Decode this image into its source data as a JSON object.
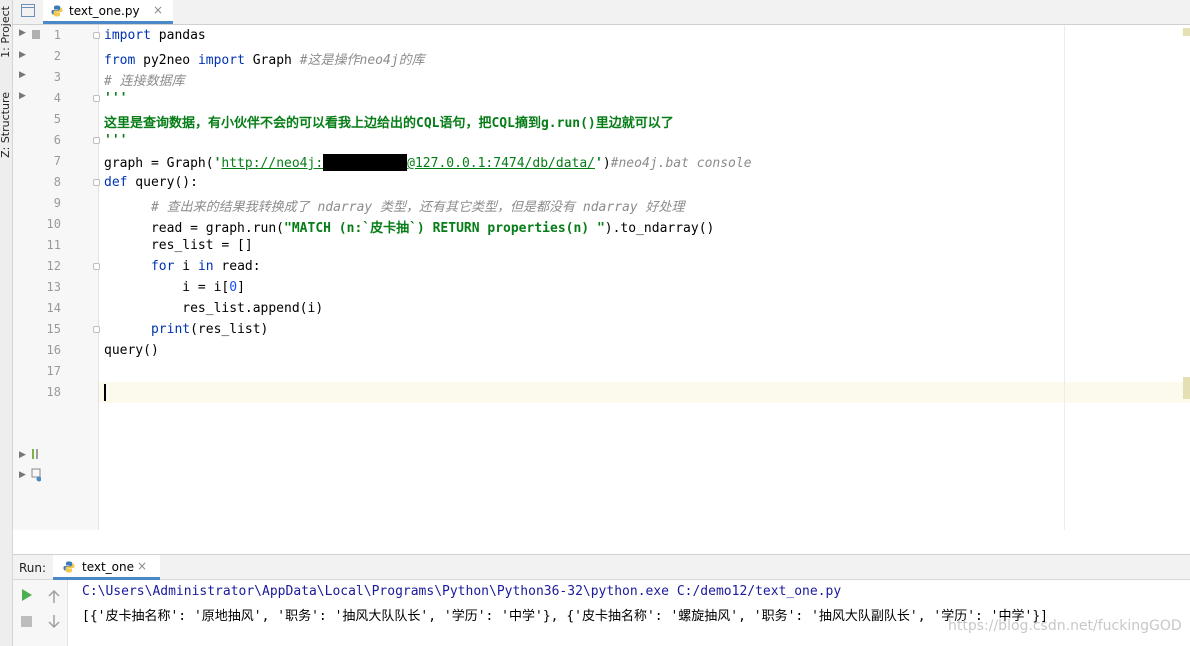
{
  "toolwindows": {
    "project": "1: Project",
    "structure": "Z: Structure"
  },
  "editor_tab": {
    "title": "text_one.py",
    "close": "×"
  },
  "code_lines": [
    {
      "n": "1",
      "tokens": [
        [
          "kw",
          "import"
        ],
        [
          "",
          " pandas"
        ]
      ]
    },
    {
      "n": "2",
      "tokens": [
        [
          "kw",
          "from"
        ],
        [
          "",
          " py2neo "
        ],
        [
          "kw",
          "import"
        ],
        [
          "",
          " Graph "
        ],
        [
          "cmt",
          "#这是操作neo4j的库"
        ]
      ]
    },
    {
      "n": "3",
      "tokens": [
        [
          "cmt",
          "# 连接数据库"
        ]
      ]
    },
    {
      "n": "4",
      "tokens": [
        [
          "str",
          "'''"
        ]
      ]
    },
    {
      "n": "5",
      "tokens": [
        [
          "str",
          "这里是查询数据，有小伙伴不会的可以看我上边给出的CQL语句，把CQL摘到g.run()里边就可以了"
        ]
      ]
    },
    {
      "n": "6",
      "tokens": [
        [
          "str",
          "'''"
        ]
      ]
    },
    {
      "n": "7",
      "tokens": [
        [
          "",
          "graph = Graph("
        ],
        [
          "str",
          "'"
        ],
        [
          "url",
          "http://neo4j:"
        ],
        [
          "redact",
          ""
        ],
        [
          "url",
          "@127.0.0.1:7474/db/data/"
        ],
        [
          "str",
          "'"
        ],
        [
          "",
          ")"
        ],
        [
          "cmt",
          "#neo4j.bat console"
        ]
      ]
    },
    {
      "n": "8",
      "tokens": [
        [
          "kw",
          "def"
        ],
        [
          "",
          " query():"
        ]
      ]
    },
    {
      "n": "9",
      "tokens": [
        [
          "",
          "      "
        ],
        [
          "cmt",
          "# 查出来的结果我转换成了 ndarray 类型，还有其它类型，但是都没有 ndarray 好处理"
        ]
      ]
    },
    {
      "n": "10",
      "tokens": [
        [
          "",
          "      read = graph.run("
        ],
        [
          "str",
          "\"MATCH (n:`皮卡抽`) RETURN properties(n) \""
        ],
        [
          "",
          ").to_ndarray()"
        ]
      ]
    },
    {
      "n": "11",
      "tokens": [
        [
          "",
          "      res_list = []"
        ]
      ]
    },
    {
      "n": "12",
      "tokens": [
        [
          "",
          "      "
        ],
        [
          "kw",
          "for"
        ],
        [
          "",
          " i "
        ],
        [
          "kw",
          "in"
        ],
        [
          "",
          " read:"
        ]
      ]
    },
    {
      "n": "13",
      "tokens": [
        [
          "",
          "          i = i["
        ],
        [
          "num",
          "0"
        ],
        [
          "",
          "]"
        ]
      ]
    },
    {
      "n": "14",
      "tokens": [
        [
          "",
          "          res_list.append(i)"
        ]
      ]
    },
    {
      "n": "15",
      "tokens": [
        [
          "",
          "      "
        ],
        [
          "kw",
          "print"
        ],
        [
          "",
          "(res_list)"
        ]
      ]
    },
    {
      "n": "16",
      "tokens": [
        [
          "",
          "query()"
        ]
      ]
    },
    {
      "n": "17",
      "tokens": []
    },
    {
      "n": "18",
      "tokens": []
    }
  ],
  "run_panel": {
    "label": "Run:",
    "tab_title": "text_one",
    "tab_close": "×",
    "command": "C:\\Users\\Administrator\\AppData\\Local\\Programs\\Python\\Python36-32\\python.exe C:/demo12/text_one.py",
    "output": "[{'皮卡抽名称': '原地抽风', '职务': '抽风大队队长', '学历': '中学'}, {'皮卡抽名称': '螺旋抽风', '职务': '抽风大队副队长', '学历': '中学'}]",
    "command_color": "#1a1a9c",
    "output_color": "#000000"
  },
  "watermark": "https://blog.csdn.net/fuckingGOD",
  "colors": {
    "accent": "#4a88c7",
    "keyword": "#0033b3",
    "comment": "#8c8c8c",
    "string": "#067d17",
    "number": "#1750eb"
  }
}
